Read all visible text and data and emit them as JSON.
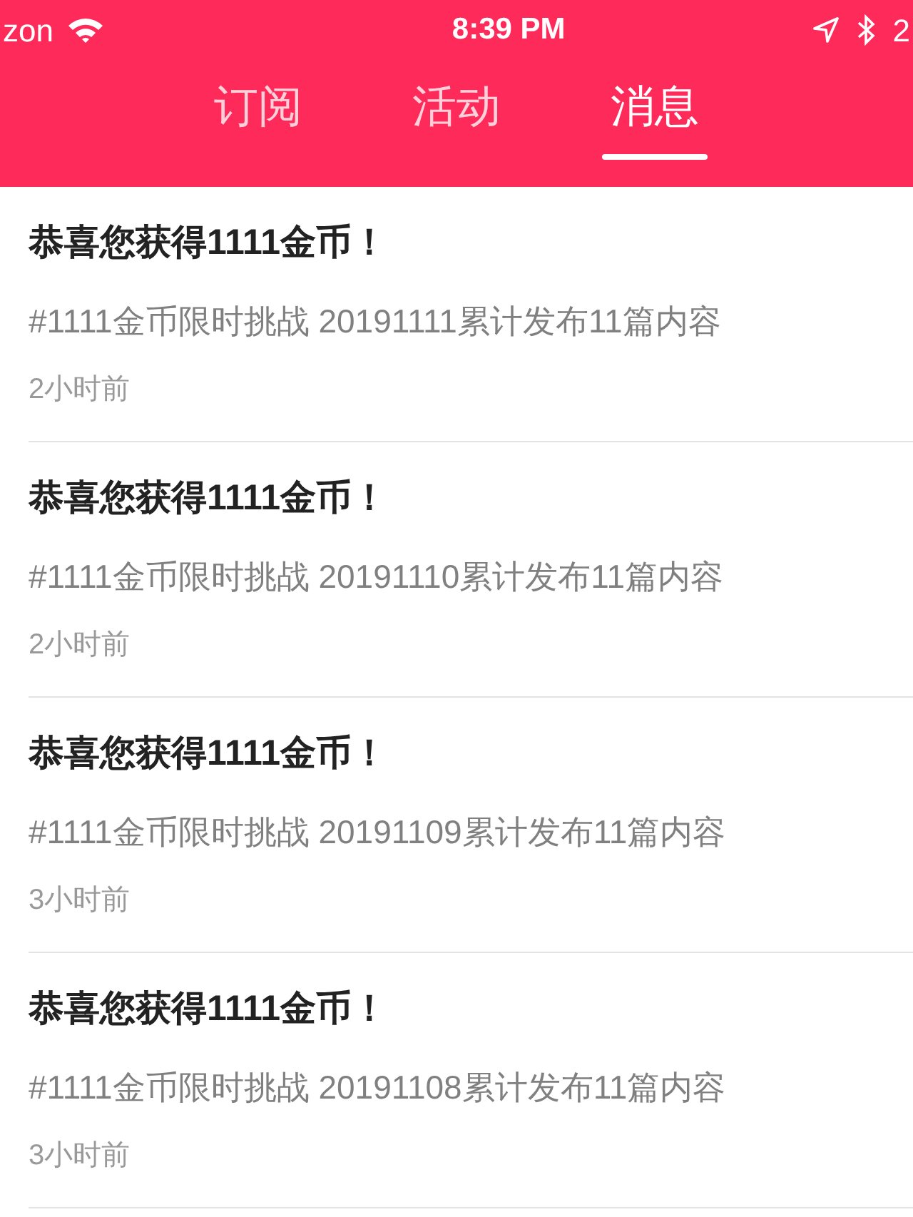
{
  "status_bar": {
    "carrier": "zon",
    "time": "8:39 PM",
    "battery": "2"
  },
  "tabs": [
    {
      "label": "订阅",
      "selected": false
    },
    {
      "label": "活动",
      "selected": false
    },
    {
      "label": "消息",
      "selected": true
    }
  ],
  "messages": [
    {
      "title": "恭喜您获得1111金币！",
      "body": "#1111金币限时挑战 20191111累计发布11篇内容",
      "time": "2小时前"
    },
    {
      "title": "恭喜您获得1111金币！",
      "body": "#1111金币限时挑战 20191110累计发布11篇内容",
      "time": "2小时前"
    },
    {
      "title": "恭喜您获得1111金币！",
      "body": "#1111金币限时挑战 20191109累计发布11篇内容",
      "time": "3小时前"
    },
    {
      "title": "恭喜您获得1111金币！",
      "body": "#1111金币限时挑战 20191108累计发布11篇内容",
      "time": "3小时前"
    }
  ]
}
